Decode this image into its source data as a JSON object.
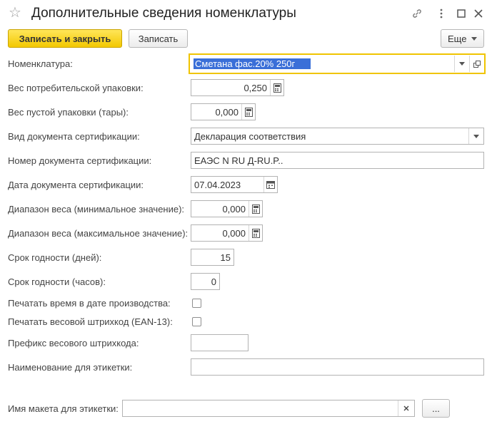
{
  "window": {
    "title": "Дополнительные сведения номенклатуры"
  },
  "toolbar": {
    "save_close_label": "Записать и закрыть",
    "save_label": "Записать",
    "more_label": "Еще"
  },
  "fields": {
    "nomenclature": {
      "label": "Номенклатура:",
      "value": "Сметана фас.20%  250г"
    },
    "consumer_pack_weight": {
      "label": "Вес потребительской упаковки:",
      "value": "0,250"
    },
    "empty_pack_weight": {
      "label": "Вес пустой упаковки (тары):",
      "value": "0,000"
    },
    "cert_doc_type": {
      "label": "Вид документа сертификации:",
      "value": "Декларация соответствия"
    },
    "cert_doc_number": {
      "label": "Номер документа сертификации:",
      "value": "ЕАЭС N RU Д-RU.P.."
    },
    "cert_doc_date": {
      "label": "Дата документа сертификации:",
      "value": "07.04.2023"
    },
    "weight_min": {
      "label": "Диапазон веса (минимальное значение):",
      "value": "0,000"
    },
    "weight_max": {
      "label": "Диапазон веса (максимальное значение):",
      "value": "0,000"
    },
    "shelf_days": {
      "label": "Срок годности (дней):",
      "value": "15"
    },
    "shelf_hours": {
      "label": "Срок годности (часов):",
      "value": "0"
    },
    "print_time": {
      "label": "Печатать время в дате производства:",
      "checked": false
    },
    "print_weight_barcode": {
      "label": "Печатать весовой штрихкод (EAN-13):",
      "checked": false
    },
    "barcode_prefix": {
      "label": "Префикс весового штрихкода:",
      "value": ""
    },
    "label_name": {
      "label": "Наименование для этикетки:",
      "value": ""
    },
    "label_template": {
      "label": "Имя макета для этикетки:",
      "value": "",
      "browse_label": "..."
    }
  },
  "colors": {
    "primary_button": "#f3c800",
    "focus_border": "#f0c400",
    "selection": "#3a6fd8"
  }
}
